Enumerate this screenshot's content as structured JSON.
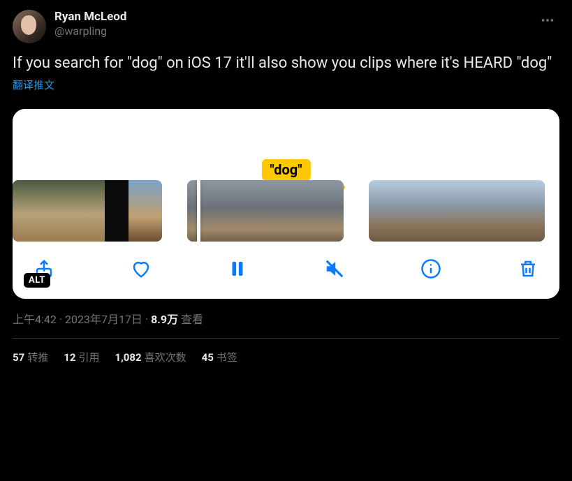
{
  "author": {
    "display_name": "Ryan McLeod",
    "handle": "@warpling"
  },
  "tweet_text": "If you search for \"dog\" on iOS 17 it'll also show you clips where it's HEARD \"dog\"",
  "translate_label": "翻译推文",
  "media": {
    "search_badge": "\"dog\"",
    "alt_badge": "ALT",
    "toolbar_icons": [
      "share-icon",
      "heart-icon",
      "pause-icon",
      "mute-icon",
      "info-icon",
      "trash-icon"
    ]
  },
  "meta": {
    "time": "上午4:42",
    "dot": " · ",
    "date": "2023年7月17日",
    "views_num": "8.9万",
    "views_label": " 查看"
  },
  "stats": {
    "retweets_num": "57",
    "retweets_label": "转推",
    "quotes_num": "12",
    "quotes_label": "引用",
    "likes_num": "1,082",
    "likes_label": "喜欢次数",
    "bookmarks_num": "45",
    "bookmarks_label": "书签"
  }
}
